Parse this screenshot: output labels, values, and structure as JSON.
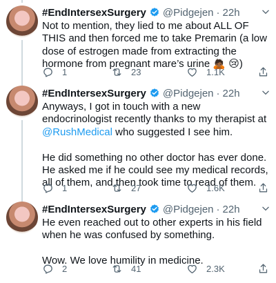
{
  "author": {
    "name": "#EndIntersexSurgery",
    "handle": "@Pidgejen",
    "time": "22h",
    "separator": "·"
  },
  "tweets": [
    {
      "text": "Not to mention, they lied to me about ALL OF THIS and then forced me to take Premarin (a low dose of estrogen made from extracting the hormone from pregnant mare’s urine 🙇🏾 😢)",
      "replies": "1",
      "retweets": "23",
      "likes": "1.1K"
    },
    {
      "text_before": "Anyways, I got in touch with a new endocrinologist recently thanks to my therapist at ",
      "mention": "@RushMedical",
      "text_after": "  who suggested I see him.\n\nHe did something no other doctor has ever done. He asked me if he could see my medical records, all of them, and then took time to read of them.",
      "replies": "1",
      "retweets": "27",
      "likes": "1.6K"
    },
    {
      "text": "He even reached out to other experts in his field when he was confused by something.\n\nWow. We love humility in medicine.",
      "replies": "2",
      "retweets": "41",
      "likes": "2.3K"
    }
  ],
  "colors": {
    "text": "#0f1419",
    "secondary": "#536471",
    "link": "#1d9bf0",
    "thread_line": "#cfd9de"
  },
  "icons": [
    "verified-badge-icon",
    "chevron-down-icon",
    "reply-icon",
    "retweet-icon",
    "like-icon",
    "share-icon"
  ]
}
